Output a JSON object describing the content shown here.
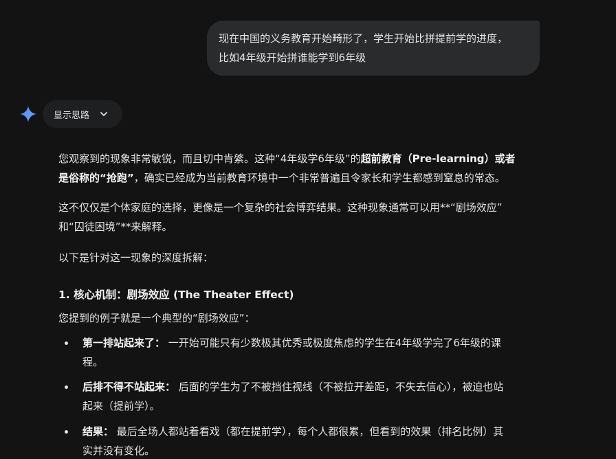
{
  "user_message": {
    "line1": "现在中国的义务教育开始畸形了，学生开始比拼提前学的进度，",
    "line2": "比如4年级开始拼谁能学到6年级"
  },
  "thoughts_toggle": {
    "label": "显示思路",
    "icon": "chevron-down-icon"
  },
  "assistant_icon": "gemini-sparkle-icon",
  "accent_colors": {
    "sparkle_top": "#4f8df5",
    "sparkle_bottom": "#6ea6ff"
  },
  "response": {
    "p1": {
      "l1_a": "您观察到的现象非常敏锐，而且切中肯綮。这种“4年级学6年级”的",
      "l1_b": "超前教育（Pre-learning）或者",
      "l2_a": "是俗称的“抢跑”",
      "l2_b": "，确实已经成为当前教育环境中一个非常普遍且令家长和学生都感到窒息的常态。"
    },
    "p2": {
      "l1": "这不仅仅是个体家庭的选择，更像是一个复杂的社会博弈结果。这种现象通常可以用**“剧场效应”",
      "l2": "和“囚徒困境”**来解释。"
    },
    "p3": "以下是针对这一现象的深度拆解：",
    "section1_title": "1. 核心机制：剧场效应 (The Theater Effect)",
    "section1_intro": "您提到的例子就是一个典型的“剧场效应”：",
    "bullets": [
      {
        "label": "第一排站起来了：",
        "l1": " 一开始可能只有少数极其优秀或极度焦虑的学生在4年级学完了6年级的课",
        "l2": "程。"
      },
      {
        "label": "后排不得不站起来：",
        "l1": " 后面的学生为了不被挡住视线（不被拉开差距，不失去信心），被迫也站",
        "l2": "起来（提前学）。"
      },
      {
        "label": "结果：",
        "l1": " 最后全场人都站着看戏（都在提前学），每个人都很累，但看到的效果（排名比例）其",
        "l2": "实并没有变化。"
      }
    ]
  }
}
